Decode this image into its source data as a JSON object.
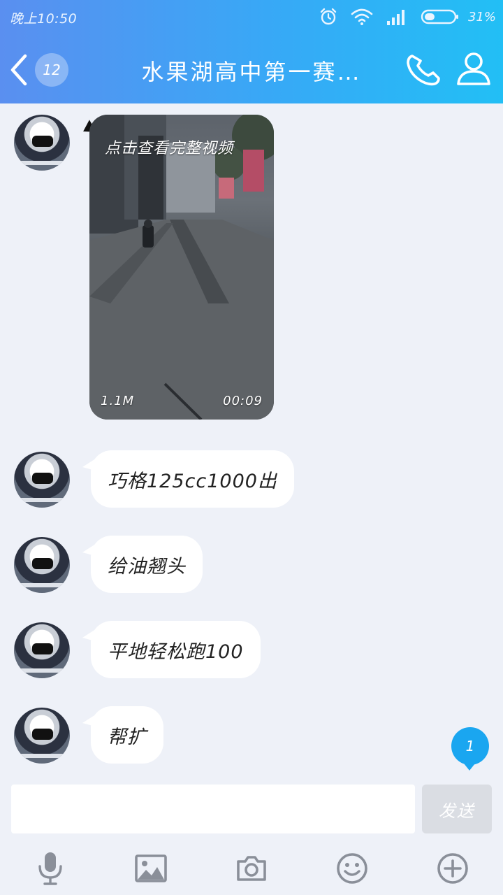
{
  "status_bar": {
    "time": "晚上10:50",
    "battery_percent": "31%"
  },
  "header": {
    "unread_count": "12",
    "title": "水果湖高中第一赛…"
  },
  "messages": [
    {
      "type": "video",
      "overlay_text": "点击查看完整视频",
      "size": "1.1M",
      "duration": "00:09"
    },
    {
      "type": "text",
      "text": "巧格125cc1000出"
    },
    {
      "type": "text",
      "text": "给油翘头"
    },
    {
      "type": "text",
      "text": "平地轻松跑100"
    },
    {
      "type": "text",
      "text": "帮扩"
    }
  ],
  "new_message_badge": "1",
  "composer": {
    "input_value": "",
    "send_label": "发送"
  },
  "toolbar": {
    "icons": [
      "microphone-icon",
      "image-icon",
      "camera-icon",
      "emoji-icon",
      "plus-icon"
    ]
  },
  "colors": {
    "header_start": "#5a8ff0",
    "header_end": "#22bff5",
    "badge_blue": "#1aa6f0",
    "background": "#eef1f8"
  }
}
